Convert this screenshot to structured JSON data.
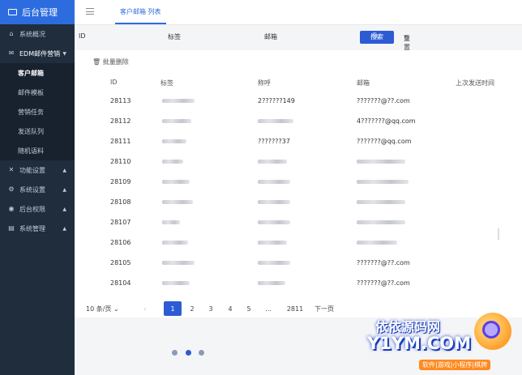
{
  "sidebar": {
    "logo": "后台管理",
    "items": [
      {
        "label": "系统概况",
        "icon": "home-icon"
      },
      {
        "label": "EDM邮件营销",
        "icon": "mail-icon",
        "open": true
      },
      {
        "label": "功能设置",
        "icon": "tool-icon"
      },
      {
        "label": "系统设置",
        "icon": "gear-icon"
      },
      {
        "label": "后台权限",
        "icon": "user-icon"
      },
      {
        "label": "系统管理",
        "icon": "server-icon"
      }
    ],
    "submenu": [
      "客户邮箱",
      "邮件模板",
      "营销任务",
      "发送队列",
      "随机语料"
    ],
    "active_sub": "客户邮箱"
  },
  "topbar": {
    "tab": "客户邮箱 列表"
  },
  "search": {
    "id_label": "ID",
    "tag_label": "标签",
    "email_label": "邮箱",
    "search_button": "搜索",
    "reset_button": "重置"
  },
  "toolbar": {
    "batch_delete": "批量删除"
  },
  "table": {
    "headers": [
      "ID",
      "标签",
      "称呼",
      "邮箱",
      "上次发送时间"
    ],
    "rows": [
      {
        "id": "28113",
        "nick": "2??????149",
        "email": "???????@??.com"
      },
      {
        "id": "28112",
        "nick": "",
        "email": "4???????@qq.com"
      },
      {
        "id": "28111",
        "nick": "???????37",
        "email": "???????@qq.com"
      },
      {
        "id": "28110",
        "nick": "",
        "email": ""
      },
      {
        "id": "28109",
        "nick": "",
        "email": ""
      },
      {
        "id": "28108",
        "nick": "",
        "email": ""
      },
      {
        "id": "28107",
        "nick": "",
        "email": ""
      },
      {
        "id": "28106",
        "nick": "",
        "email": ""
      },
      {
        "id": "28105",
        "nick": "",
        "email": "???????@??.com"
      },
      {
        "id": "28104",
        "nick": "",
        "email": "???????@??.com"
      }
    ]
  },
  "pagination": {
    "page_size": "10 条/页",
    "pages": [
      "1",
      "2",
      "3",
      "4",
      "5",
      "...",
      "2811"
    ],
    "current": "1",
    "next": "下一页"
  },
  "watermark": {
    "title": "依依源码网",
    "domain": "Y1YM.COM",
    "subtitle": "软件|游戏|小程序|棋牌"
  },
  "colors": {
    "accent": "#2d5bd4",
    "sidebar": "#1f2d3d",
    "logo_bg": "#2d6cdf"
  }
}
